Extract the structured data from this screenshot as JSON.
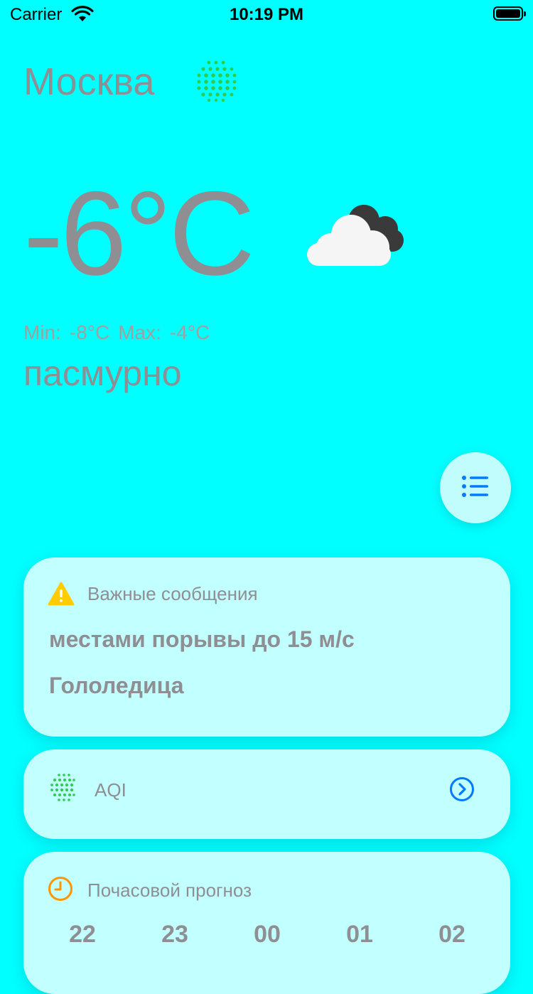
{
  "status_bar": {
    "carrier": "Carrier",
    "time": "10:19 PM"
  },
  "city": "Москва",
  "temperature": "-6°C",
  "weather_icon": "cloudy-night-icon",
  "min_label": "Min:",
  "min_value": "-8°C",
  "max_label": "Max:",
  "max_value": "-4°C",
  "condition": "пасмурно",
  "alerts": {
    "title": "Важные сообщения",
    "messages": [
      "местами порывы до 15 м/с",
      "Гололедица"
    ]
  },
  "aqi": {
    "label": "AQI"
  },
  "hourly": {
    "title": "Почасовой прогноз",
    "hours": [
      "22",
      "23",
      "00",
      "01",
      "02"
    ]
  },
  "colors": {
    "background": "#00FFFF",
    "card": "#C2FFFF",
    "text": "#8E8E93",
    "accent_blue": "#007AFF",
    "aqi_green": "#34C759",
    "warning_yellow": "#FFCC00",
    "clock_orange": "#FF9500"
  }
}
